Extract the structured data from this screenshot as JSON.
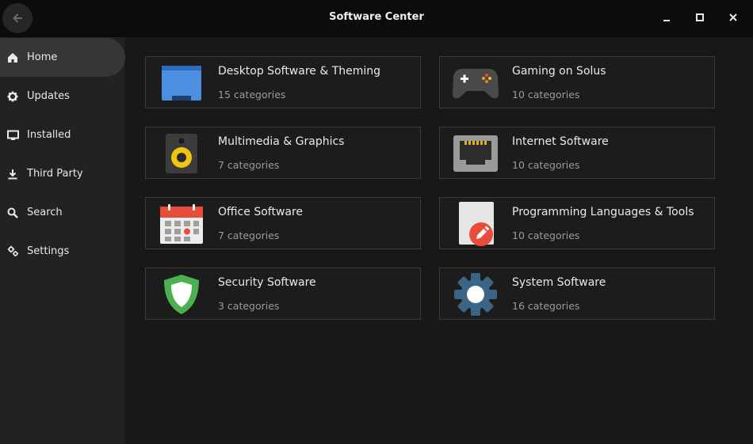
{
  "window": {
    "title": "Software Center"
  },
  "sidebar": {
    "items": [
      {
        "label": "Home",
        "icon": "home-icon",
        "active": true
      },
      {
        "label": "Updates",
        "icon": "gear-icon"
      },
      {
        "label": "Installed",
        "icon": "monitor-icon"
      },
      {
        "label": "Third Party",
        "icon": "download-icon"
      },
      {
        "label": "Search",
        "icon": "search-icon"
      },
      {
        "label": "Settings",
        "icon": "settings-icon"
      }
    ]
  },
  "categories": [
    {
      "title": "Desktop Software & Theming",
      "subtitle": "15 categories",
      "icon": "desktop-window-icon"
    },
    {
      "title": "Gaming on Solus",
      "subtitle": "10 categories",
      "icon": "gamepad-icon"
    },
    {
      "title": "Multimedia & Graphics",
      "subtitle": "7 categories",
      "icon": "speaker-icon"
    },
    {
      "title": "Internet Software",
      "subtitle": "10 categories",
      "icon": "ethernet-port-icon"
    },
    {
      "title": "Office Software",
      "subtitle": "7 categories",
      "icon": "calendar-icon"
    },
    {
      "title": "Programming Languages & Tools",
      "subtitle": "10 categories",
      "icon": "document-edit-icon"
    },
    {
      "title": "Security Software",
      "subtitle": "3 categories",
      "icon": "shield-icon"
    },
    {
      "title": "System Software",
      "subtitle": "16 categories",
      "icon": "cog-icon"
    }
  ],
  "colors": {
    "titlebar": "#0c0c0c",
    "sidebar": "#222222",
    "active_item": "#363636",
    "main": "#181818",
    "card_border": "#3a3a3a"
  }
}
